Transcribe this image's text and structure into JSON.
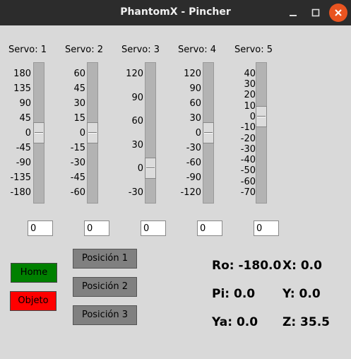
{
  "window": {
    "title": "PhantomX - Pincher"
  },
  "servos": [
    {
      "label": "Servo: 1",
      "ticks": [
        "180",
        "135",
        "90",
        "45",
        "0",
        "-45",
        "-90",
        "-135",
        "-180"
      ],
      "value_fraction": 0.5,
      "entry_value": "0"
    },
    {
      "label": "Servo: 2",
      "ticks": [
        "60",
        "45",
        "30",
        "15",
        "0",
        "-15",
        "-30",
        "-45",
        "-60"
      ],
      "value_fraction": 0.5,
      "entry_value": "0"
    },
    {
      "label": "Servo: 3",
      "ticks": [
        "120",
        "90",
        "60",
        "30",
        "0",
        "-30"
      ],
      "value_fraction": 0.8,
      "entry_value": "0"
    },
    {
      "label": "Servo: 4",
      "ticks": [
        "120",
        "90",
        "60",
        "30",
        "0",
        "-30",
        "-60",
        "-90",
        "-120"
      ],
      "value_fraction": 0.5,
      "entry_value": "0"
    },
    {
      "label": "Servo: 5",
      "ticks": [
        "40",
        "30",
        "20",
        "10",
        "0",
        "-10",
        "-20",
        "-30",
        "-40",
        "-50",
        "-60",
        "-70"
      ],
      "value_fraction": 0.3636,
      "entry_value": "0"
    }
  ],
  "buttons": {
    "home": {
      "label": "Home",
      "color": "#008000"
    },
    "objeto": {
      "label": "Objeto",
      "color": "#ff0000"
    },
    "positions": [
      "Posición 1",
      "Posición 2",
      "Posición 3"
    ]
  },
  "readouts": {
    "ro": "Ro: -180.0",
    "pi": "Pi: 0.0",
    "ya": "Ya: 0.0",
    "x": "X: 0.0",
    "y": "Y: 0.0",
    "z": "Z: 35.5"
  }
}
